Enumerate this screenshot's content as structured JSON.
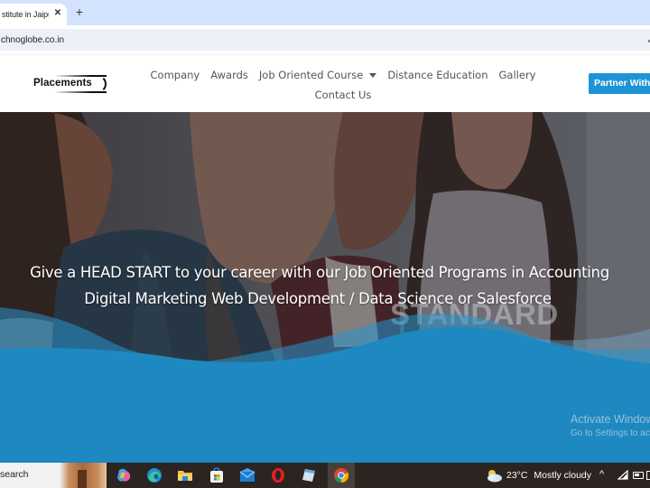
{
  "browser": {
    "tab_title": "stitute in Jaipur",
    "tab_close_icon": "close-icon",
    "new_tab_icon": "plus-icon",
    "url": "chnoglobe.co.in"
  },
  "header": {
    "logo_text": "Placements",
    "nav": [
      {
        "label": "Company"
      },
      {
        "label": "Awards"
      },
      {
        "label": "Job Oriented Course",
        "has_dropdown": true
      },
      {
        "label": "Distance Education"
      },
      {
        "label": "Gallery"
      },
      {
        "label": "Contact Us"
      }
    ],
    "partner_button": "Partner With"
  },
  "hero": {
    "line1": "Give a HEAD START to your career with our Job Oriented Programs in Accounting",
    "line2": "Digital Marketing Web Development / Data Science or Salesforce",
    "watermark": "STANDARD",
    "wave_color": "#1e88c0"
  },
  "windows_watermark": {
    "title": "Activate Windows",
    "subtitle": "Go to Settings to activate Windows."
  },
  "taskbar": {
    "search_label": "search",
    "apps": [
      {
        "name": "copilot-icon"
      },
      {
        "name": "edge-icon"
      },
      {
        "name": "file-explorer-icon"
      },
      {
        "name": "microsoft-store-icon"
      },
      {
        "name": "mail-icon"
      },
      {
        "name": "opera-icon"
      },
      {
        "name": "notepad-icon"
      },
      {
        "name": "chrome-icon",
        "active": true
      }
    ],
    "weather": {
      "temperature": "23°C",
      "condition": "Mostly cloudy",
      "icon": "partly-cloudy-icon"
    },
    "tray_icons": [
      "chevron-up-icon",
      "network-icon",
      "battery-icon"
    ]
  }
}
